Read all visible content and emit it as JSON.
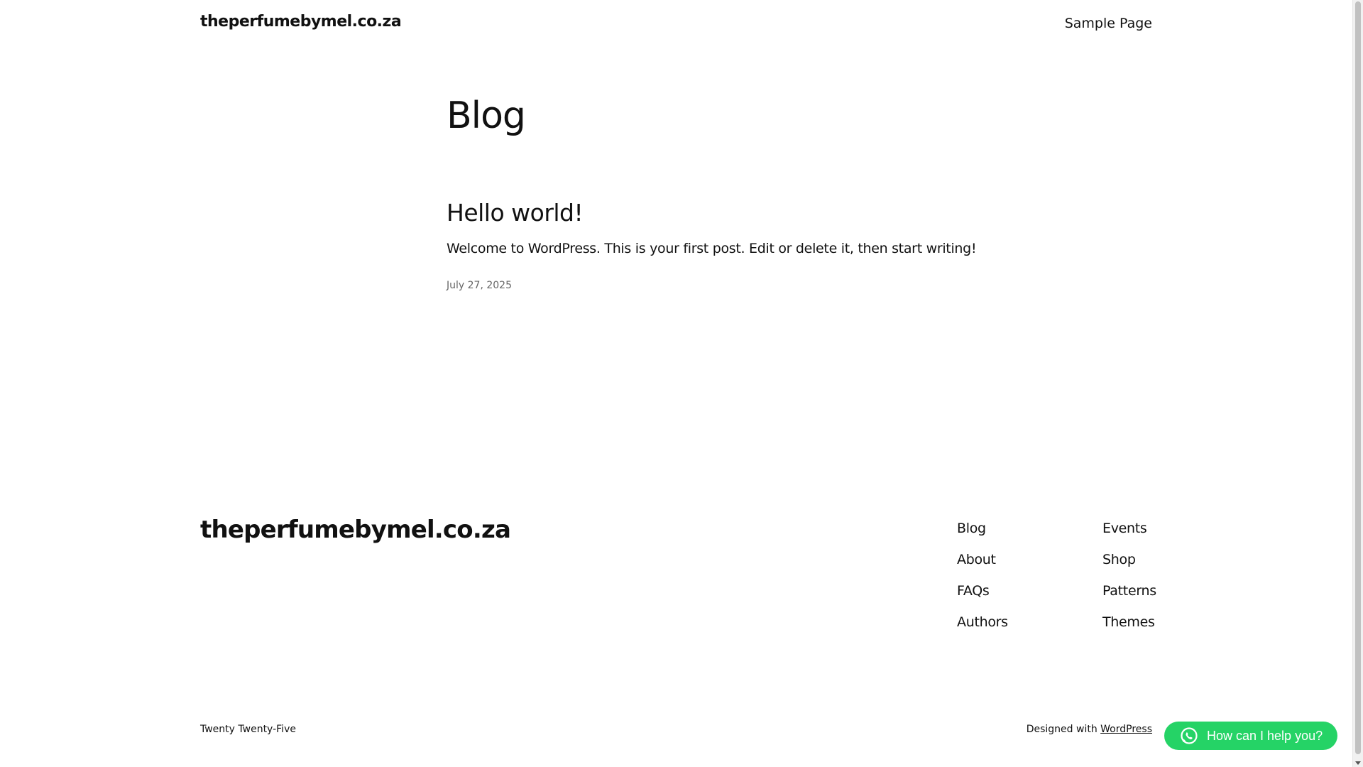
{
  "header": {
    "site_title": "theperfumebymel.co.za",
    "nav": [
      {
        "label": "Sample Page"
      }
    ]
  },
  "main": {
    "heading": "Blog",
    "posts": [
      {
        "title": "Hello world!",
        "excerpt": "Welcome to WordPress. This is your first post. Edit or delete it, then start writing!",
        "date": "July 27, 2025"
      }
    ]
  },
  "footer": {
    "site_title": "theperfumebymel.co.za",
    "col1": [
      {
        "label": "Blog"
      },
      {
        "label": "About"
      },
      {
        "label": "FAQs"
      },
      {
        "label": "Authors"
      }
    ],
    "col2": [
      {
        "label": "Events"
      },
      {
        "label": "Shop"
      },
      {
        "label": "Patterns"
      },
      {
        "label": "Themes"
      }
    ],
    "theme_name": "Twenty Twenty-Five",
    "designed_with_prefix": "Designed with",
    "designed_with_link": "WordPress"
  },
  "whatsapp": {
    "label": "How can I help you?",
    "icon": "whatsapp-icon",
    "color": "#25d366"
  }
}
